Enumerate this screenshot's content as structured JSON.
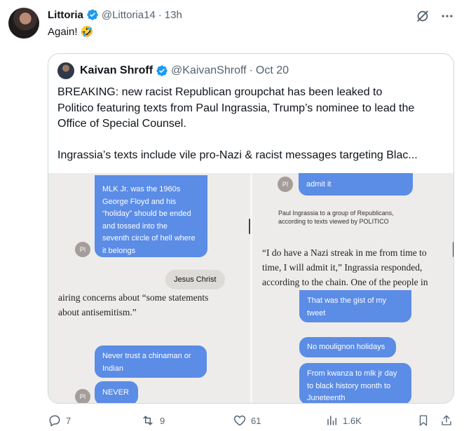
{
  "tweet": {
    "author_name": "Littoria",
    "author_handle": "@Littoria14",
    "time": "13h",
    "text": "Again! 🤣"
  },
  "quote": {
    "author_name": "Kaivan Shroff",
    "author_handle": "@KaivanShroff",
    "date": "Oct 20",
    "lines": [
      "BREAKING: new racist Republican groupchat has been leaked to",
      "Politico featuring texts from Paul Ingrassia, Trump’s nominee to lead the",
      "Office of Special Counsel.",
      "Ingrassia’s texts include vile pro-Nazi & racist messages targeting Blac..."
    ]
  },
  "media": {
    "panel1": {
      "bubble": [
        "MLK Jr. was the 1960s",
        "George Floyd and his",
        "“holiday” should be ended",
        "and tossed into the",
        "seventh circle of hell where",
        "it belongs"
      ],
      "initials": "PI",
      "reply": "Jesus Christ"
    },
    "panel2": {
      "bubble": "admit it",
      "initials": "PI",
      "caption": [
        "Paul Ingrassia to a group of Republicans,",
        "according to texts viewed by POLITICO"
      ],
      "article": [
        "“I do have a Nazi streak in me from time to",
        "time, I will admit it,” Ingrassia responded,",
        "according to the chain. One of the people in"
      ]
    },
    "panel3": {
      "article": [
        "airing concerns about “some statements",
        "about antisemitism.”"
      ],
      "bubble1": [
        "Never trust a chinaman or",
        "Indian"
      ],
      "bubble2": "NEVER",
      "initials": "PI"
    },
    "panel4": {
      "bubble1": [
        "That was the gist of my",
        "tweet"
      ],
      "bubble2": "No moulignon holidays",
      "bubble3": [
        "From kwanza to mlk jr day",
        "to black history month to",
        "Juneteenth"
      ]
    }
  },
  "actions": {
    "replies": "7",
    "reposts": "9",
    "likes": "61",
    "views": "1.6K"
  },
  "colors": {
    "verified": "#1d9bf0",
    "muted": "#536471",
    "bubble": "#5b8ce6"
  }
}
